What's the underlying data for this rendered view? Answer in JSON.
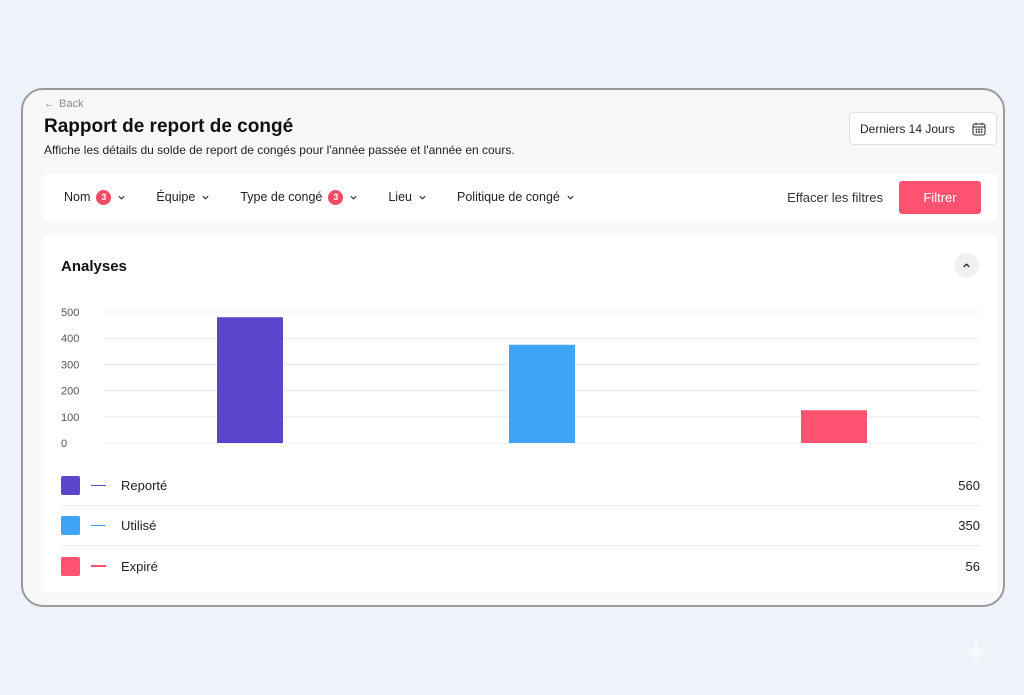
{
  "header": {
    "back_label": "Back",
    "title": "Rapport de report de congé",
    "subtitle": "Affiche les détails du solde de report de congés pour l'année passée et l'année en cours.",
    "date_range": "Derniers 14 Jours"
  },
  "filters": {
    "items": [
      {
        "label": "Nom",
        "badge": "3"
      },
      {
        "label": "Équipe",
        "badge": ""
      },
      {
        "label": "Type de congé",
        "badge": "3"
      },
      {
        "label": "Lieu",
        "badge": ""
      },
      {
        "label": "Politique de congé",
        "badge": ""
      }
    ],
    "clear_label": "Effacer les filtres",
    "apply_label": "Filtrer"
  },
  "analytics": {
    "title": "Analyses"
  },
  "chart_data": {
    "type": "bar",
    "categories": [
      "Reporté",
      "Utilisé",
      "Expiré"
    ],
    "values": [
      480,
      375,
      125
    ],
    "colors": [
      "#5b45cc",
      "#3ea4f5",
      "#fd5270"
    ],
    "ylim": [
      0,
      500
    ],
    "yticks": [
      "0",
      "100",
      "200",
      "300",
      "400",
      "500"
    ],
    "grid": true
  },
  "legend": [
    {
      "label": "Reporté",
      "value": "560",
      "color": "#5b45cc"
    },
    {
      "label": "Utilisé",
      "value": "350",
      "color": "#3ea4f5"
    },
    {
      "label": "Expiré",
      "value": "56",
      "color": "#fd5270"
    }
  ]
}
